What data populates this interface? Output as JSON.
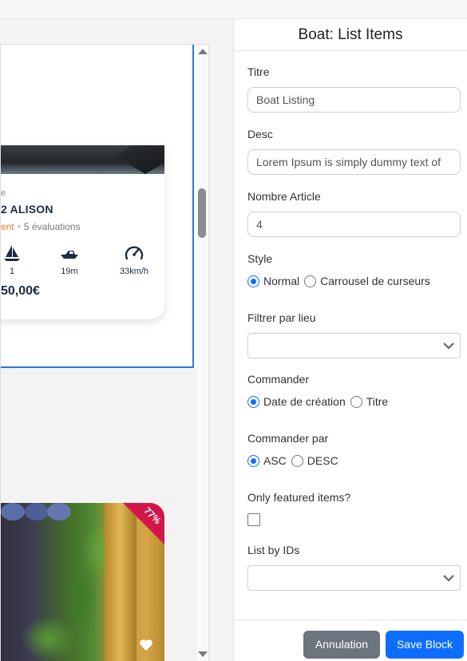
{
  "preview": {
    "card1": {
      "subtitle": "e",
      "title": "2 ALISON",
      "rating_text": "ent",
      "reviews": "5 évaluations",
      "features": [
        {
          "icon": "sailboat-icon",
          "value": "1"
        },
        {
          "icon": "speedboat-icon",
          "value": "19m"
        },
        {
          "icon": "speedometer-icon",
          "value": "33km/h"
        }
      ],
      "price": "50,00€"
    },
    "card2": {
      "discount_badge": "77%"
    }
  },
  "panel": {
    "title": "Boat: List Items",
    "fields": {
      "titre_label": "Titre",
      "titre_value": "Boat Listing",
      "desc_label": "Desc",
      "desc_value": "Lorem Ipsum is simply dummy text of",
      "nombre_label": "Nombre Article",
      "nombre_value": "4",
      "style_label": "Style",
      "style_options": [
        "Normal",
        "Carrousel de curseurs"
      ],
      "style_selected": "Normal",
      "filtrer_label": "Filtrer par lieu",
      "filtrer_value": "",
      "commander_label": "Commander",
      "commander_options": [
        "Date de création",
        "Titre"
      ],
      "commander_selected": "Date de création",
      "commander_par_label": "Commander par",
      "commander_par_options": [
        "ASC",
        "DESC"
      ],
      "commander_par_selected": "ASC",
      "featured_label": "Only featured items?",
      "featured_checked": false,
      "ids_label": "List by IDs",
      "ids_value": ""
    },
    "buttons": {
      "cancel": "Annulation",
      "save": "Save Block"
    }
  },
  "colors": {
    "accent": "#0d6efd",
    "cancel": "#6c757d",
    "selection": "#2a7ad6",
    "badge": "#d3164a",
    "rating": "#e07a2c"
  }
}
